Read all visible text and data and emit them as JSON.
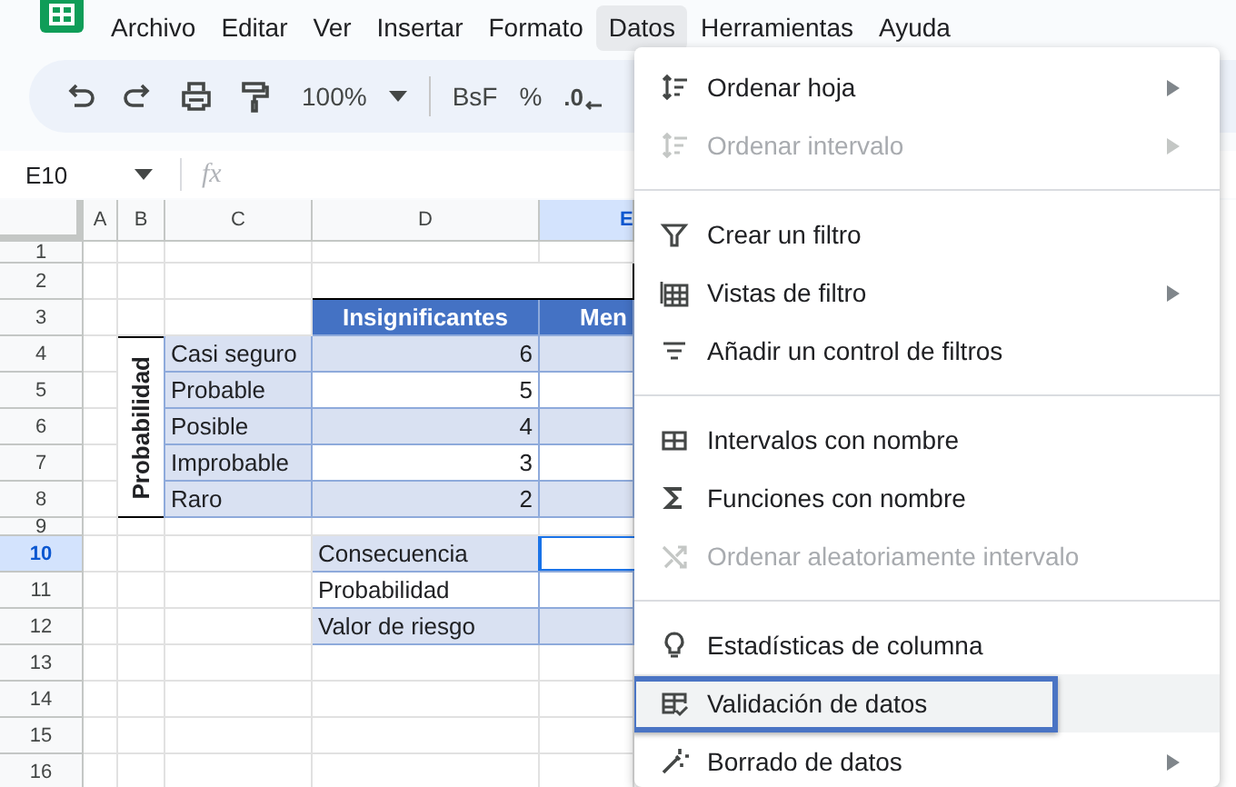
{
  "menubar": {
    "items": [
      {
        "label": "Archivo",
        "selected": false
      },
      {
        "label": "Editar",
        "selected": false
      },
      {
        "label": "Ver",
        "selected": false
      },
      {
        "label": "Insertar",
        "selected": false
      },
      {
        "label": "Formato",
        "selected": false
      },
      {
        "label": "Datos",
        "selected": true
      },
      {
        "label": "Herramientas",
        "selected": false
      },
      {
        "label": "Ayuda",
        "selected": false
      }
    ]
  },
  "toolbar": {
    "zoom": "100%",
    "format_buttons": [
      "BsF",
      "%"
    ],
    "decimal_button": ".0"
  },
  "formula_bar": {
    "name_box": "E10",
    "formula_label": "fx"
  },
  "columns": [
    {
      "label": "A",
      "selected": false
    },
    {
      "label": "B",
      "selected": false
    },
    {
      "label": "C",
      "selected": false
    },
    {
      "label": "D",
      "selected": false
    },
    {
      "label": "E",
      "selected": true
    }
  ],
  "row_headers": [
    {
      "label": "1",
      "selected": false
    },
    {
      "label": "2",
      "selected": false
    },
    {
      "label": "3",
      "selected": false
    },
    {
      "label": "4",
      "selected": false
    },
    {
      "label": "5",
      "selected": false
    },
    {
      "label": "6",
      "selected": false
    },
    {
      "label": "7",
      "selected": false
    },
    {
      "label": "8",
      "selected": false
    },
    {
      "label": "9",
      "selected": false
    },
    {
      "label": "10",
      "selected": true
    },
    {
      "label": "11",
      "selected": false
    },
    {
      "label": "12",
      "selected": false
    },
    {
      "label": "13",
      "selected": false
    },
    {
      "label": "14",
      "selected": false
    },
    {
      "label": "15",
      "selected": false
    },
    {
      "label": "16",
      "selected": false
    }
  ],
  "matrix": {
    "headers": [
      "Insignificantes",
      "Men"
    ],
    "side_label": "Probabilidad",
    "rows": [
      {
        "label": "Casi seguro",
        "value": "6",
        "shaded": true
      },
      {
        "label": "Probable",
        "value": "5",
        "shaded": false
      },
      {
        "label": "Posible",
        "value": "4",
        "shaded": true
      },
      {
        "label": "Improbable",
        "value": "3",
        "shaded": false
      },
      {
        "label": "Raro",
        "value": "2",
        "shaded": true
      }
    ]
  },
  "inputs": [
    {
      "label": "Consecuencia",
      "shaded": true,
      "selected": true
    },
    {
      "label": "Probabilidad",
      "shaded": false,
      "selected": false
    },
    {
      "label": "Valor de riesgo",
      "shaded": true,
      "selected": false
    }
  ],
  "menu": {
    "items": [
      {
        "kind": "item",
        "label": "Ordenar hoja",
        "disabled": false,
        "submenu": true,
        "highlighted": false
      },
      {
        "kind": "item",
        "label": "Ordenar intervalo",
        "disabled": true,
        "submenu": true,
        "highlighted": false
      },
      {
        "kind": "divider"
      },
      {
        "kind": "item",
        "label": "Crear un filtro",
        "disabled": false,
        "submenu": false,
        "highlighted": false
      },
      {
        "kind": "item",
        "label": "Vistas de filtro",
        "disabled": false,
        "submenu": true,
        "highlighted": false
      },
      {
        "kind": "item",
        "label": "Añadir un control de filtros",
        "disabled": false,
        "submenu": false,
        "highlighted": false
      },
      {
        "kind": "divider"
      },
      {
        "kind": "item",
        "label": "Intervalos con nombre",
        "disabled": false,
        "submenu": false,
        "highlighted": false
      },
      {
        "kind": "item",
        "label": "Funciones con nombre",
        "disabled": false,
        "submenu": false,
        "highlighted": false
      },
      {
        "kind": "item",
        "label": "Ordenar aleatoriamente intervalo",
        "disabled": true,
        "submenu": false,
        "highlighted": false
      },
      {
        "kind": "divider"
      },
      {
        "kind": "item",
        "label": "Estadísticas de columna",
        "disabled": false,
        "submenu": false,
        "highlighted": false
      },
      {
        "kind": "item",
        "label": "Validación de datos",
        "disabled": false,
        "submenu": false,
        "highlighted": true
      },
      {
        "kind": "item",
        "label": "Borrado de datos",
        "disabled": false,
        "submenu": true,
        "highlighted": false
      }
    ]
  }
}
